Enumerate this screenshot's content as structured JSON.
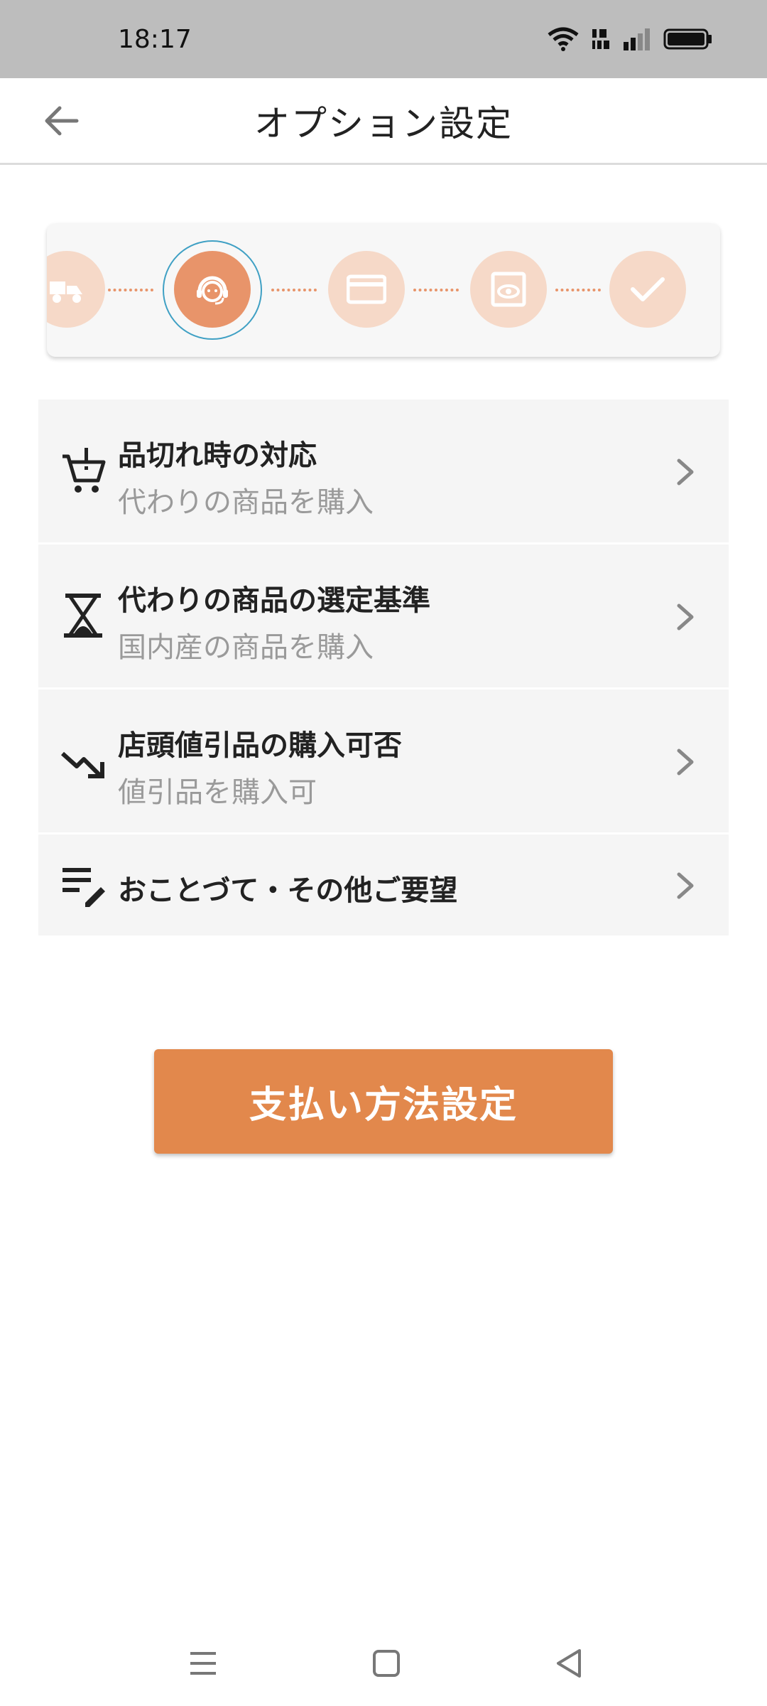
{
  "status": {
    "time": "18:17"
  },
  "header": {
    "title": "オプション設定"
  },
  "stepper": {
    "steps": [
      "delivery-icon",
      "support-agent-icon",
      "credit-card-icon",
      "preview-icon",
      "check-icon"
    ],
    "active_index": 1
  },
  "options": [
    {
      "icon": "cart-alert-icon",
      "title": "品切れ時の対応",
      "subtitle": "代わりの商品を購入"
    },
    {
      "icon": "hourglass-icon",
      "title": "代わりの商品の選定基準",
      "subtitle": "国内産の商品を購入"
    },
    {
      "icon": "trending-down-icon",
      "title": "店頭値引品の購入可否",
      "subtitle": "値引品を購入可"
    },
    {
      "icon": "notes-edit-icon",
      "title": "おことづて・その他ご要望"
    }
  ],
  "payment_button": {
    "label": "支払い方法設定"
  },
  "colors": {
    "accent": "#e2884c",
    "step_active": "#e8946a",
    "step_inactive": "#f6d9c8"
  }
}
